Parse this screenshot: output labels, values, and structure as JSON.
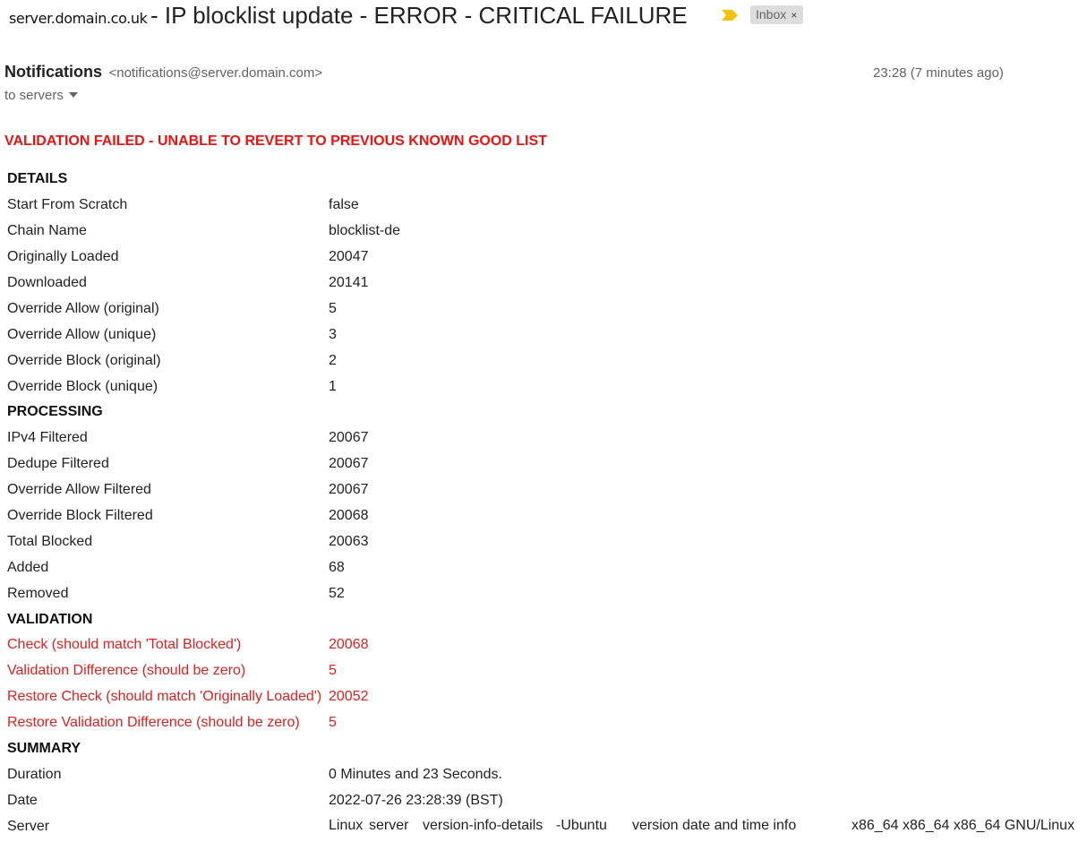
{
  "header": {
    "sender_domain": "server.domain.co.uk",
    "subject": "- IP blocklist update - ERROR - CRITICAL FAILURE",
    "label": "Inbox",
    "label_close": "×",
    "importance_color": "#f4c20d"
  },
  "from": {
    "name": "Notifications",
    "email": "<notifications@server.domain.com>",
    "time": "23:28 (7 minutes ago)",
    "to": "to servers"
  },
  "alert": "VALIDATION FAILED - UNABLE TO REVERT TO PREVIOUS KNOWN GOOD LIST",
  "report": {
    "details": {
      "title": "DETAILS",
      "rows": [
        {
          "k": "Start From Scratch",
          "v": "false"
        },
        {
          "k": "Chain Name",
          "v": "blocklist-de"
        },
        {
          "k": "Originally Loaded",
          "v": "20047"
        },
        {
          "k": "Downloaded",
          "v": "20141"
        },
        {
          "k": "Override Allow (original)",
          "v": "5"
        },
        {
          "k": "Override Allow (unique)",
          "v": "3"
        },
        {
          "k": "Override Block (original)",
          "v": "2"
        },
        {
          "k": "Override Block (unique)",
          "v": "1"
        }
      ]
    },
    "processing": {
      "title": "PROCESSING",
      "rows": [
        {
          "k": "IPv4 Filtered",
          "v": "20067"
        },
        {
          "k": "Dedupe Filtered",
          "v": "20067"
        },
        {
          "k": "Override Allow Filtered",
          "v": "20067"
        },
        {
          "k": "Override Block Filtered",
          "v": "20068"
        },
        {
          "k": "Total Blocked",
          "v": "20063"
        },
        {
          "k": "Added",
          "v": "68"
        },
        {
          "k": "Removed",
          "v": "52"
        }
      ]
    },
    "validation": {
      "title": "VALIDATION",
      "rows": [
        {
          "k": "Check (should match 'Total Blocked')",
          "v": "20068"
        },
        {
          "k": "Validation Difference (should be zero)",
          "v": "5"
        },
        {
          "k": "Restore Check (should match 'Originally Loaded')",
          "v": "20052"
        },
        {
          "k": "Restore Validation Difference (should be zero)",
          "v": "5"
        }
      ]
    },
    "summary": {
      "title": "SUMMARY",
      "duration_label": "Duration",
      "duration": "0 Minutes and 23 Seconds.",
      "date_label": "Date",
      "date": "2022-07-26 23:28:39 (BST)",
      "server_label": "Server",
      "server": {
        "os": "Linux",
        "host": "server",
        "version": "version-info-details",
        "distro": "-Ubuntu",
        "build_date": "version date and time info",
        "arch": "x86_64 x86_64 x86_64 GNU/Linux"
      }
    }
  }
}
